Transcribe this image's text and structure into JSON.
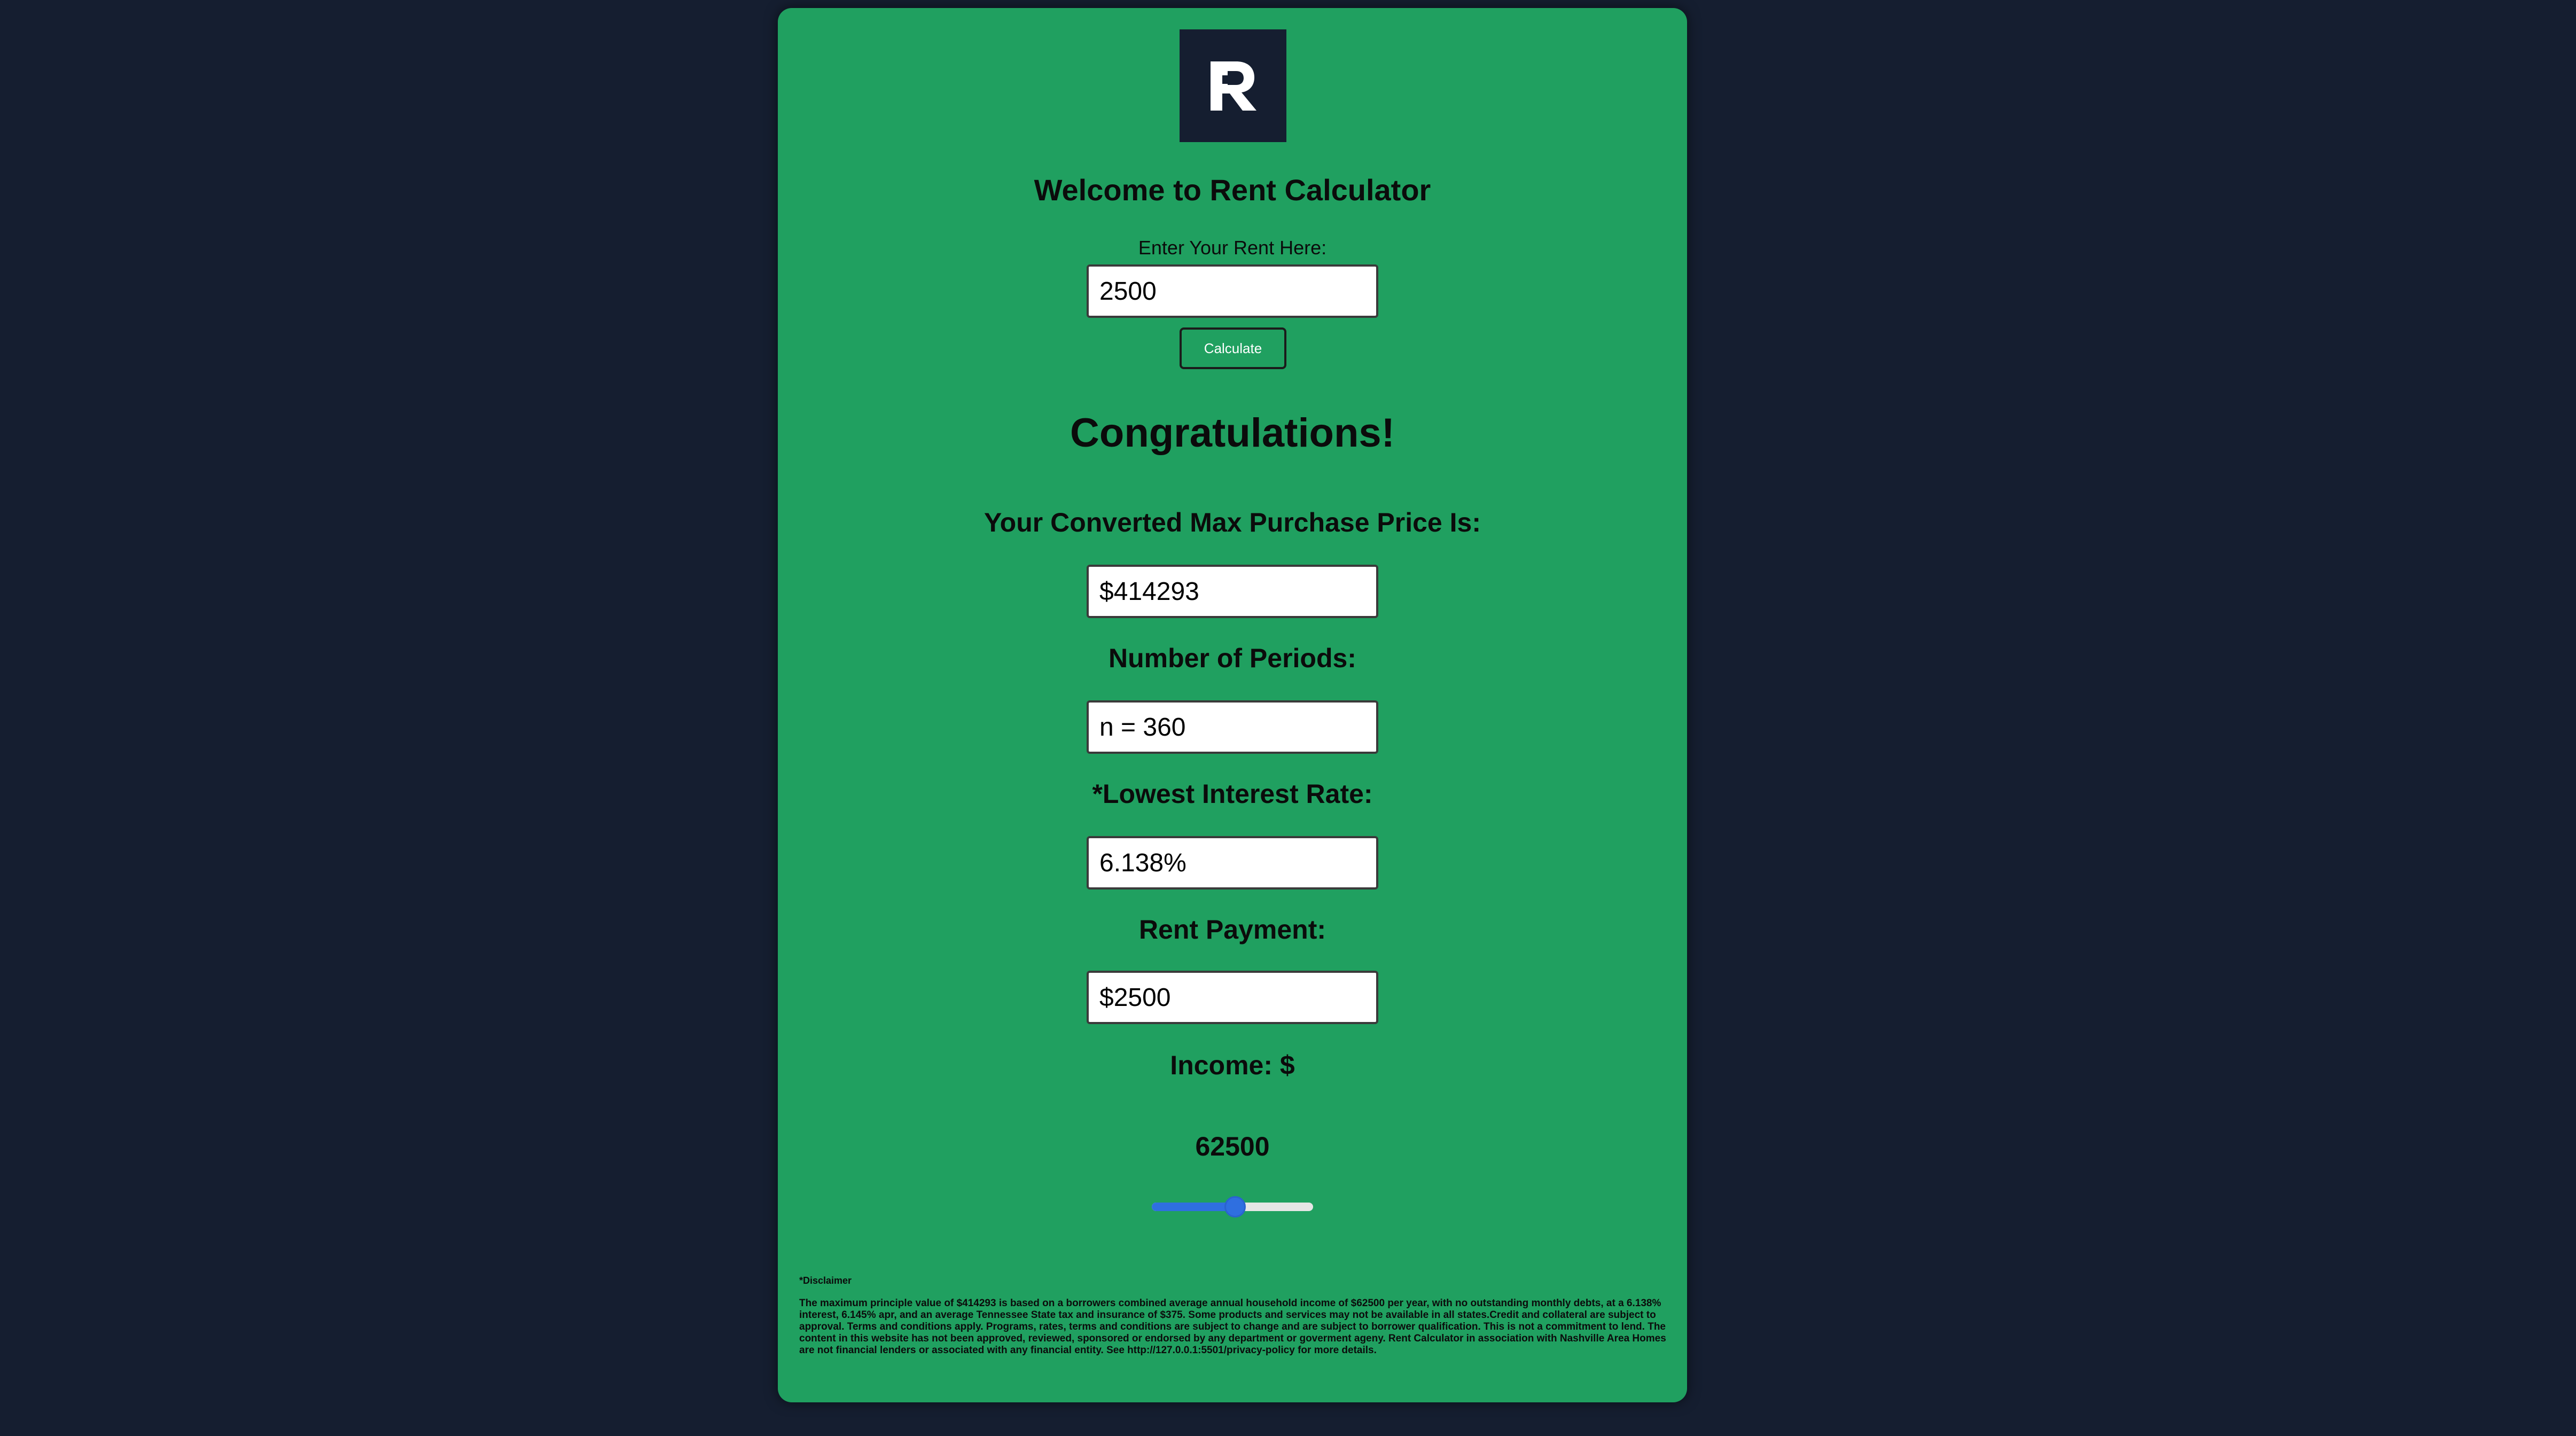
{
  "logo": {
    "letter": "R",
    "icon": "rent-calculator-logo-icon",
    "bg_color": "#151e30"
  },
  "header": {
    "welcome": "Welcome to Rent Calculator"
  },
  "rent_input": {
    "label": "Enter Your Rent Here:",
    "value": "2500"
  },
  "calculate_button": {
    "label": "Calculate"
  },
  "result": {
    "congrats": "Congratulations!",
    "max_price_label": "Your Converted Max Purchase Price Is:",
    "max_price_value": "$414293",
    "periods_label": "Number of Periods:",
    "periods_value": "n = 360",
    "interest_label": "*Lowest Interest Rate:",
    "interest_value": "6.138%",
    "rent_payment_label": "Rent Payment:",
    "rent_payment_value": "$2500",
    "income_label": "Income: $",
    "income_value": "62500"
  },
  "income_slider": {
    "level_fraction": 0.52,
    "accent_color": "#2f6fe0"
  },
  "disclaimer": {
    "title": "*Disclaimer",
    "text": "The maximum principle value of $414293 is based on a borrowers combined average annual household income of $62500 per year, with no outstanding monthly debts, at a 6.138% interest, 6.145% apr, and an average Tennessee State tax and insurance of $375. Some products and services may not be available in all states.Credit and collateral are subject to approval. Terms and conditions apply. Programs, rates, terms and conditions are subject to change and are subject to borrower qualification. This is not a commitment to lend. The content in this website has not been approved, reviewed, sponsored or endorsed by any department or goverment ageny. Rent Calculator in association with Nashville Area Homes are not financial lenders or associated with any financial entity. See http://127.0.0.1:5501/privacy-policy for more details."
  },
  "colors": {
    "page_bg": "#151e30",
    "card_bg": "#20a060"
  }
}
